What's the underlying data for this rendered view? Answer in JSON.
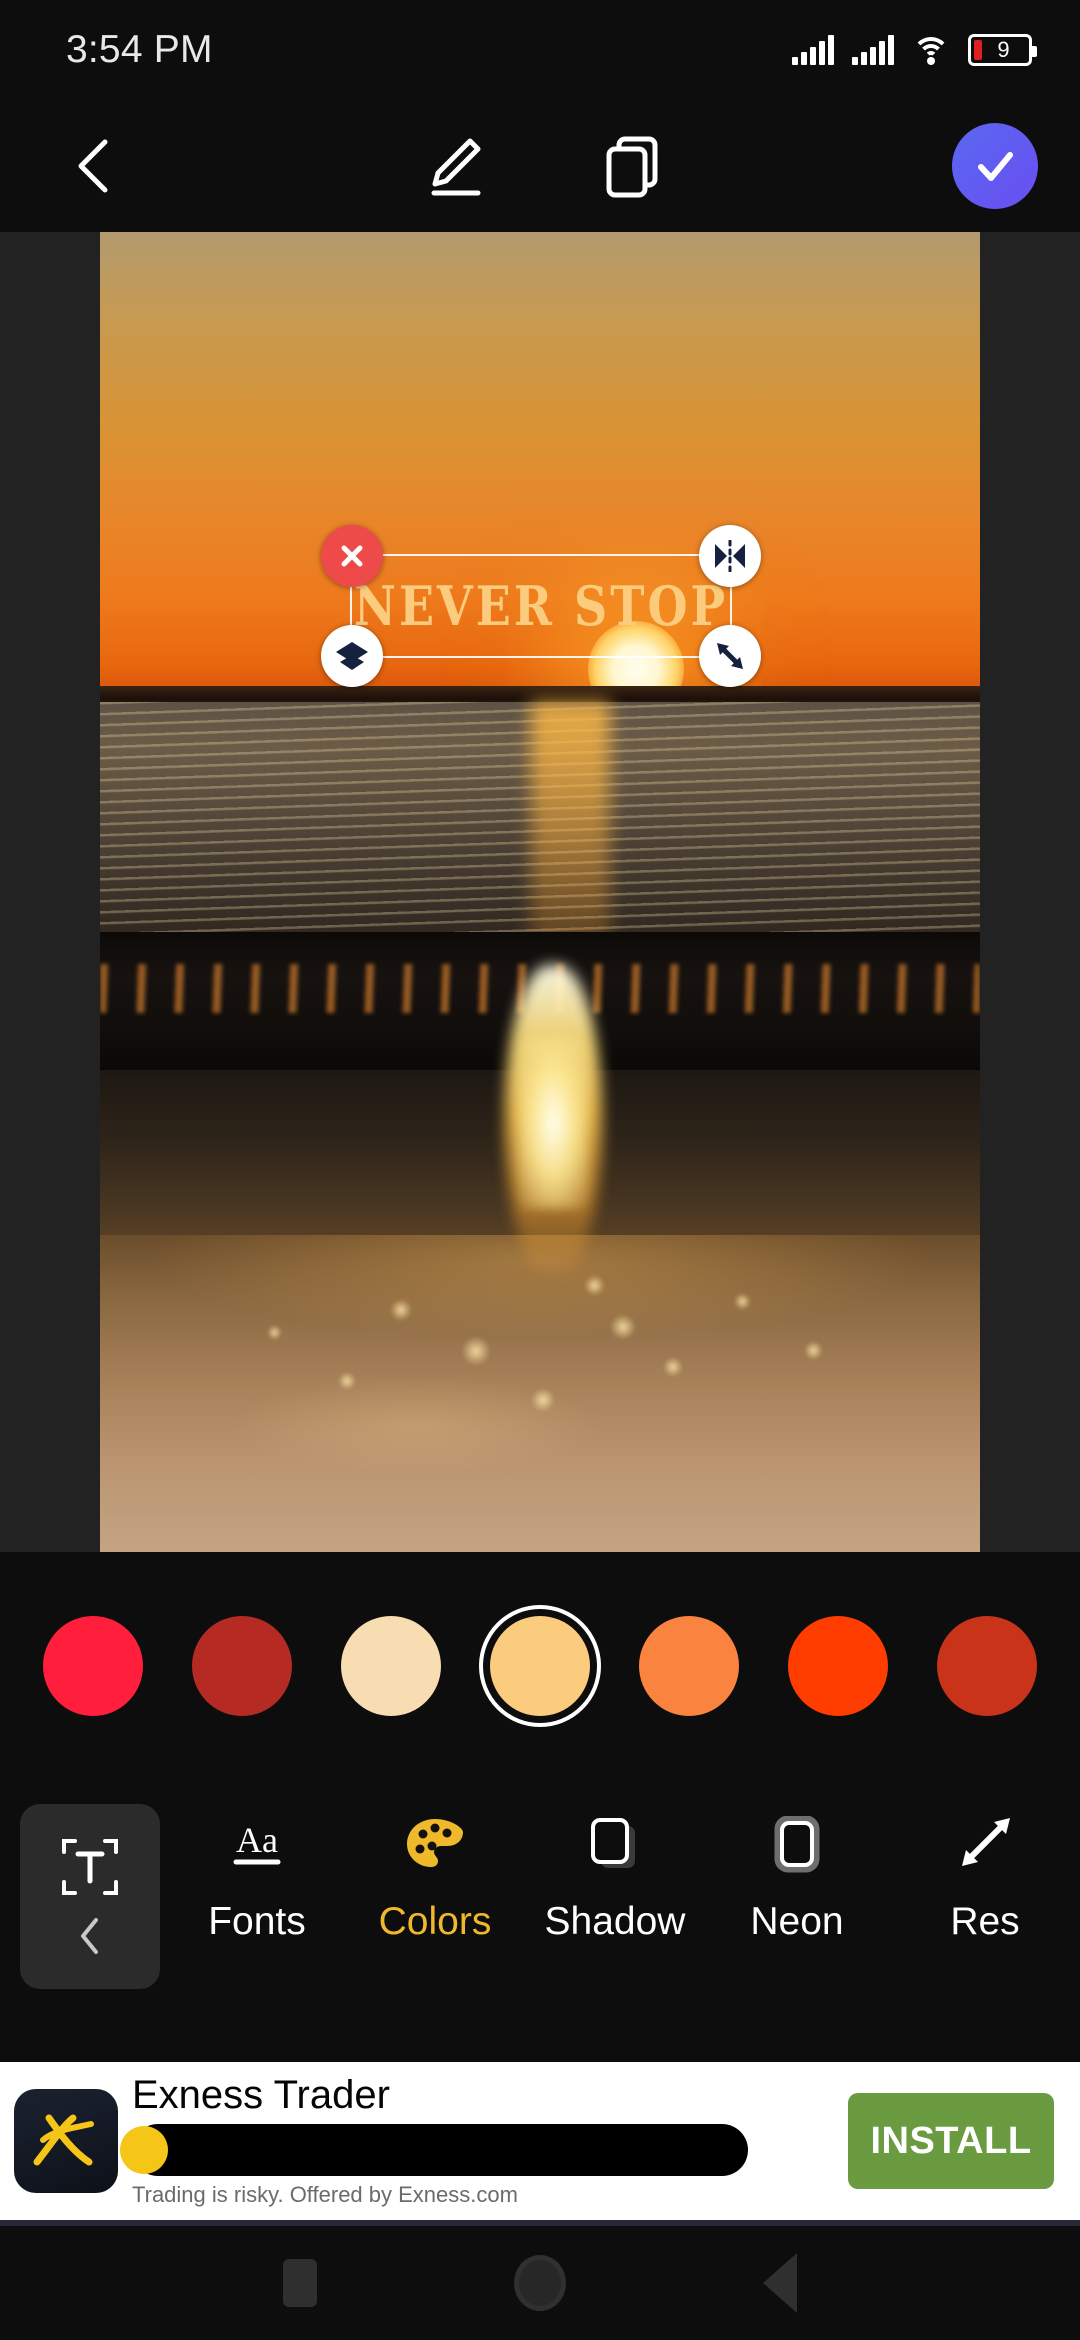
{
  "statusbar": {
    "time": "3:54 PM",
    "battery_level": "9",
    "icons": [
      "signal-icon",
      "signal-icon",
      "wifi-icon",
      "battery-icon"
    ]
  },
  "toolbar": {
    "back_label": "back-chevron",
    "edit_label": "pencil",
    "layers_label": "duplicate-layers",
    "done_label": "done-check"
  },
  "editor": {
    "overlay_text": "Never Stop",
    "handles": {
      "delete": "delete-handle",
      "mirror": "mirror-handle",
      "layer": "layer-handle",
      "resize": "resize-handle"
    }
  },
  "palette": {
    "selected_index": 3,
    "swatches": [
      {
        "name": "crimson",
        "hex": "#FF1F3D"
      },
      {
        "name": "brick-red",
        "hex": "#B52A22"
      },
      {
        "name": "cream",
        "hex": "#F8DCB2"
      },
      {
        "name": "golden-tan",
        "hex": "#FBCB7E"
      },
      {
        "name": "orange",
        "hex": "#FB8340"
      },
      {
        "name": "orange-red",
        "hex": "#FF3D00"
      },
      {
        "name": "dark-rust",
        "hex": "#C8331A"
      }
    ]
  },
  "tools": {
    "active_label": "Colors",
    "active_color": "#F0B92B",
    "text_tool": "text-tool",
    "items": [
      {
        "label": "Fonts",
        "icon": "fonts-aa-icon"
      },
      {
        "label": "Colors",
        "icon": "palette-icon"
      },
      {
        "label": "Shadow",
        "icon": "shadow-icon"
      },
      {
        "label": "Neon",
        "icon": "neon-icon"
      },
      {
        "label": "Res",
        "icon": "resize-icon"
      }
    ]
  },
  "ad": {
    "title": "Exness Trader",
    "disclaimer": "Trading is risky. Offered by Exness.com",
    "install_label": "INSTALL",
    "brand_color": "#F5C518",
    "cta_color": "#6A9B41"
  },
  "navbar": {
    "recents": "recents-square",
    "home": "home-circle",
    "back": "back-triangle"
  }
}
